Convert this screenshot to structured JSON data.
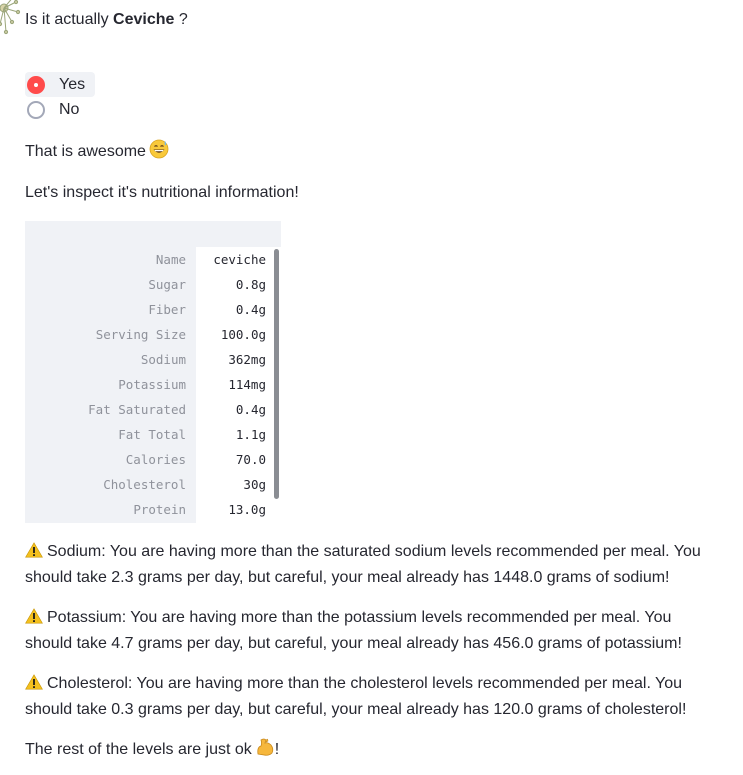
{
  "question": {
    "prefix": "Is it actually ",
    "food": "Ceviche",
    "suffix": " ?"
  },
  "radio": {
    "options": [
      "Yes",
      "No"
    ],
    "selected": "Yes",
    "accent_color": "#ff4b4b"
  },
  "response": {
    "text": "That is awesome",
    "emoji_icon": "grinning-sweat-emoji"
  },
  "inspect_text": "Let's inspect it's nutritional information!",
  "nutrition_table": {
    "rows": [
      {
        "key": "Name",
        "value": "ceviche"
      },
      {
        "key": "Sugar",
        "value": "0.8g"
      },
      {
        "key": "Fiber",
        "value": "0.4g"
      },
      {
        "key": "Serving Size",
        "value": "100.0g"
      },
      {
        "key": "Sodium",
        "value": "362mg"
      },
      {
        "key": "Potassium",
        "value": "114mg"
      },
      {
        "key": "Fat Saturated",
        "value": "0.4g"
      },
      {
        "key": "Fat Total",
        "value": "1.1g"
      },
      {
        "key": "Calories",
        "value": "70.0"
      },
      {
        "key": "Cholesterol",
        "value": "30g"
      },
      {
        "key": "Protein",
        "value": "13.0g"
      }
    ]
  },
  "warnings": [
    {
      "icon": "warning-icon",
      "line1": "Sodium: You are having more than the saturated sodium levels recommended per meal. You",
      "line2": "should take 2.3 grams per day, but careful, your meal already has 1448.0 grams of sodium!"
    },
    {
      "icon": "warning-icon",
      "line1": "Potassium: You are having more than the potassium levels recommended per meal. You",
      "line2": "should take 4.7 grams per day, but careful, your meal already has 456.0 grams of potassium!"
    },
    {
      "icon": "warning-icon",
      "line1": "Cholesterol: You are having more than the cholesterol levels recommended per meal. You",
      "line2": "should take 0.3 grams per day, but careful, your meal already has 120.0 grams of cholesterol!"
    }
  ],
  "closing": {
    "text": "The rest of the levels are just ok",
    "emoji_icon": "flexed-biceps-emoji",
    "end": "!"
  }
}
